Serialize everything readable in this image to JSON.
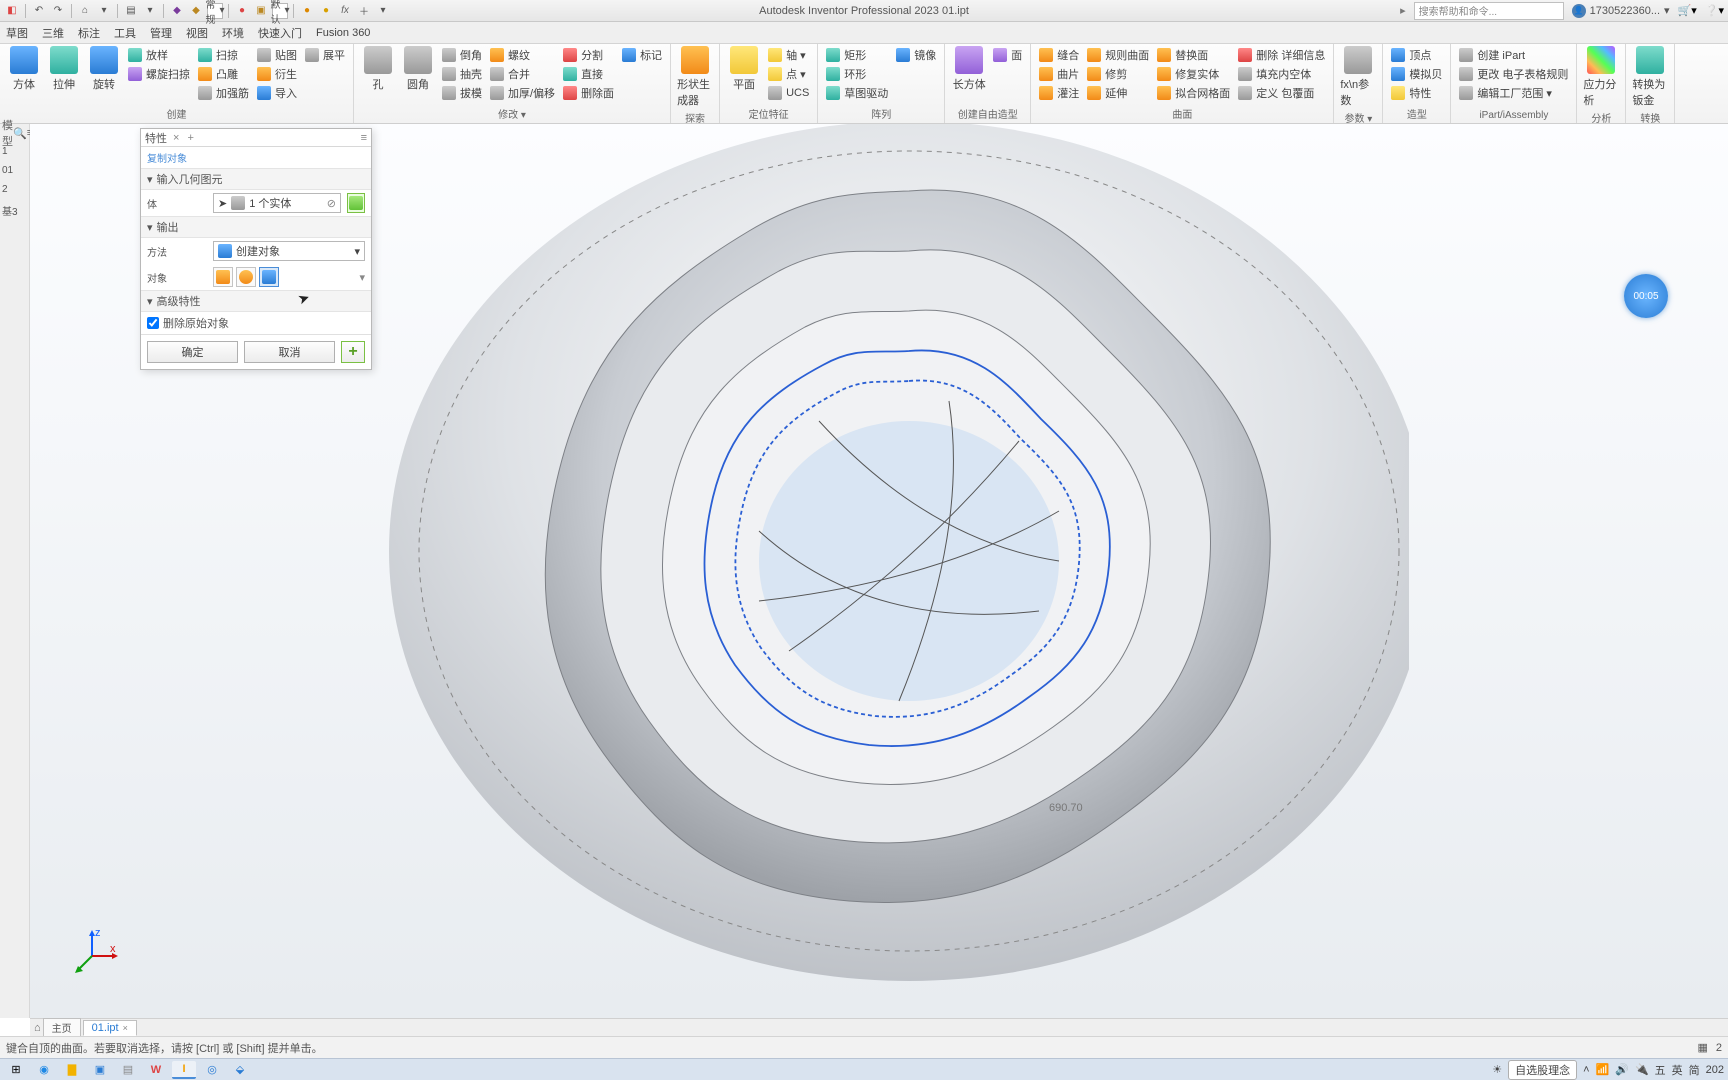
{
  "app_title": "Autodesk Inventor Professional 2023   01.ipt",
  "qat": {
    "style_dropdown": "常规",
    "color_dropdown": "默认"
  },
  "search_placeholder": "搜索帮助和命令...",
  "user_id": "1730522360...",
  "menus": [
    "草图",
    "三维",
    "标注",
    "工具",
    "管理",
    "视图",
    "环境",
    "快速入门",
    "Fusion 360"
  ],
  "ribbon": {
    "groups": [
      {
        "label": "创建",
        "big": [
          {
            "text": "方体",
            "cls": "ic-blue"
          },
          {
            "text": "拉伸",
            "cls": "ic-teal"
          },
          {
            "text": "旋转",
            "cls": "ic-blue"
          }
        ],
        "cols": [
          [
            {
              "t": "放样",
              "c": "ic-teal"
            },
            {
              "t": "螺旋扫掠",
              "c": "ic-purple"
            }
          ],
          [
            {
              "t": "扫掠",
              "c": "ic-teal"
            },
            {
              "t": "凸雕",
              "c": "ic-orange"
            },
            {
              "t": "加强筋",
              "c": "ic-gray"
            }
          ],
          [
            {
              "t": "贴图",
              "c": "ic-gray"
            },
            {
              "t": "衍生",
              "c": "ic-orange"
            },
            {
              "t": "导入",
              "c": "ic-blue"
            }
          ],
          [
            {
              "t": "展平",
              "c": "ic-gray"
            }
          ]
        ]
      },
      {
        "label": "修改 ▾",
        "big": [
          {
            "text": "孔",
            "cls": "ic-gray"
          },
          {
            "text": "圆角",
            "cls": "ic-gray"
          }
        ],
        "cols": [
          [
            {
              "t": "倒角",
              "c": "ic-gray"
            },
            {
              "t": "抽壳",
              "c": "ic-gray"
            },
            {
              "t": "拔模",
              "c": "ic-gray"
            }
          ],
          [
            {
              "t": "螺纹",
              "c": "ic-orange"
            },
            {
              "t": "合并",
              "c": "ic-gray"
            },
            {
              "t": "加厚/偏移",
              "c": "ic-gray"
            }
          ],
          [
            {
              "t": "分割",
              "c": "ic-red"
            },
            {
              "t": "直接",
              "c": "ic-teal"
            },
            {
              "t": "删除面",
              "c": "ic-red"
            }
          ],
          [
            {
              "t": "标记",
              "c": "ic-blue"
            }
          ]
        ]
      },
      {
        "label": "探索",
        "big": [
          {
            "text": "形状生成器",
            "cls": "ic-orange"
          }
        ]
      },
      {
        "label": "定位特征",
        "big": [
          {
            "text": "平面",
            "cls": "ic-yellow"
          }
        ],
        "cols": [
          [
            {
              "t": "轴 ▾",
              "c": "ic-yellow"
            },
            {
              "t": "点 ▾",
              "c": "ic-yellow"
            },
            {
              "t": "UCS",
              "c": "ic-gray"
            }
          ]
        ]
      },
      {
        "label": "阵列",
        "cols": [
          [
            {
              "t": "矩形",
              "c": "ic-teal"
            },
            {
              "t": "环形",
              "c": "ic-teal"
            },
            {
              "t": "草图驱动",
              "c": "ic-teal"
            }
          ],
          [
            {
              "t": "镜像",
              "c": "ic-blue"
            }
          ]
        ]
      },
      {
        "label": "创建自由造型",
        "big": [
          {
            "text": "长方体",
            "cls": "ic-purple"
          }
        ],
        "cols": [
          [
            {
              "t": "面",
              "c": "ic-purple"
            }
          ]
        ]
      },
      {
        "label": "曲面",
        "cols": [
          [
            {
              "t": "缝合",
              "c": "ic-orange"
            },
            {
              "t": "曲片",
              "c": "ic-orange"
            },
            {
              "t": "灌注",
              "c": "ic-orange"
            }
          ],
          [
            {
              "t": "规则曲面",
              "c": "ic-orange"
            },
            {
              "t": "修剪",
              "c": "ic-orange"
            },
            {
              "t": "延伸",
              "c": "ic-orange"
            }
          ],
          [
            {
              "t": "替换面",
              "c": "ic-orange"
            },
            {
              "t": "修复实体",
              "c": "ic-orange"
            },
            {
              "t": "拟合网格面",
              "c": "ic-orange"
            }
          ],
          [
            {
              "t": "删除 详细信息",
              "c": "ic-red"
            },
            {
              "t": "填充内空体",
              "c": "ic-gray"
            },
            {
              "t": "定义 包覆面",
              "c": "ic-gray"
            }
          ]
        ]
      },
      {
        "label": "参数 ▾",
        "big": [
          {
            "text": "fx\\n参数",
            "cls": "ic-gray"
          }
        ]
      },
      {
        "label": "造型",
        "cols": [
          [
            {
              "t": "顶点",
              "c": "ic-blue"
            },
            {
              "t": "模拟贝",
              "c": "ic-blue"
            },
            {
              "t": "特性",
              "c": "ic-yellow"
            }
          ]
        ]
      },
      {
        "label": "iPart/iAssembly",
        "cols": [
          [
            {
              "t": "创建 iPart",
              "c": "ic-gray"
            },
            {
              "t": "更改 电子表格规则",
              "c": "ic-gray"
            },
            {
              "t": "编辑工厂范围 ▾",
              "c": "ic-gray"
            }
          ]
        ]
      },
      {
        "label": "分析",
        "big": [
          {
            "text": "应力分析",
            "cls": "ic-rainbow"
          }
        ]
      },
      {
        "label": "转换",
        "big": [
          {
            "text": "转换为钣金",
            "cls": "ic-teal"
          }
        ]
      }
    ]
  },
  "left_head": "模型",
  "left_items": [
    "1",
    "01",
    "2",
    "基3"
  ],
  "panel": {
    "title": "特性",
    "subtitle": "复制对象",
    "sec_input": "输入几何图元",
    "row_body_label": "体",
    "row_body_value": "1 个实体",
    "sec_output": "输出",
    "row_method_label": "方法",
    "row_method_value": "创建对象",
    "row_target_label": "对象",
    "sec_adv": "高级特性",
    "chk_delete": "删除原始对象",
    "ok": "确定",
    "cancel": "取消"
  },
  "timer": "00:05",
  "tabs": {
    "home": "主页",
    "file": "01.ipt"
  },
  "status_hint": "键合自顶的曲面。若要取消选择，请按 [Ctrl] 或 [Shift] 提并单击。",
  "tray": {
    "mode": "自选股理念",
    "ime1": "五",
    "ime2": "英",
    "ime3": "简",
    "year": "202"
  }
}
